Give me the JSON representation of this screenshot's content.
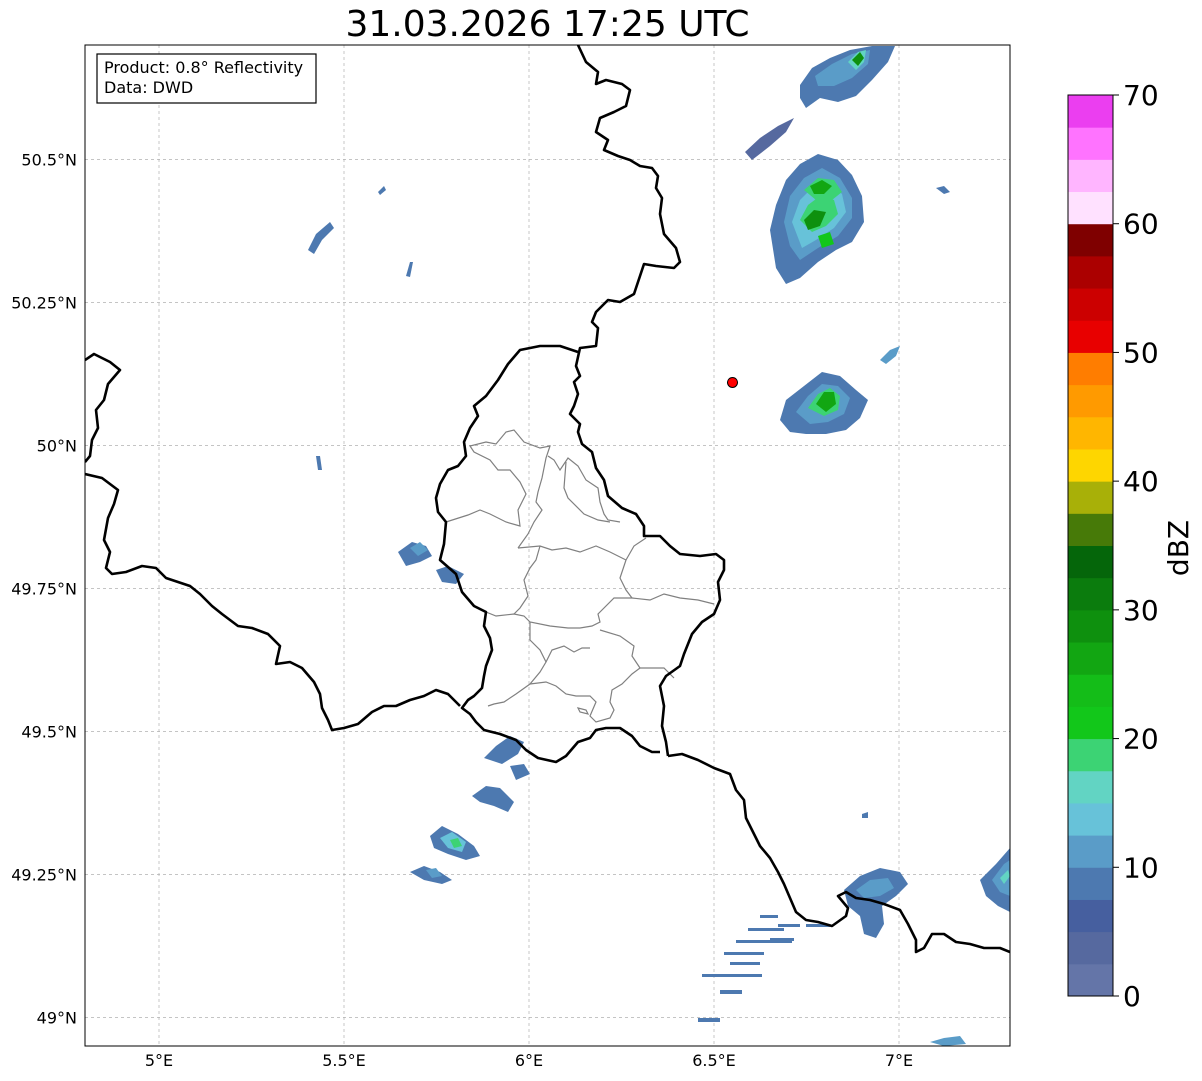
{
  "title": "31.03.2026 17:25 UTC",
  "info_box": {
    "product_line": "Product: 0.8° Reflectivity",
    "data_line": "Data: DWD"
  },
  "map": {
    "type": "radar-reflectivity-map",
    "extent": {
      "lon_min": 4.8,
      "lon_max": 7.3,
      "lat_min": 48.95,
      "lat_max": 50.7
    },
    "grid": true,
    "lon_ticks": [
      {
        "value": 5.0,
        "label": "5°E"
      },
      {
        "value": 5.5,
        "label": "5.5°E"
      },
      {
        "value": 6.0,
        "label": "6°E"
      },
      {
        "value": 6.5,
        "label": "6.5°E"
      },
      {
        "value": 7.0,
        "label": "7°E"
      }
    ],
    "lat_ticks": [
      {
        "value": 50.5,
        "label": "50.5°N"
      },
      {
        "value": 50.25,
        "label": "50.25°N"
      },
      {
        "value": 50.0,
        "label": "50°N"
      },
      {
        "value": 49.75,
        "label": "49.75°N"
      },
      {
        "value": 49.5,
        "label": "49.5°N"
      },
      {
        "value": 49.25,
        "label": "49.25°N"
      },
      {
        "value": 49.0,
        "label": "49°N"
      }
    ],
    "radar_site": {
      "lon": 6.55,
      "lat": 50.11,
      "color": "#ff0000"
    },
    "echoes": [
      {
        "lon": 6.87,
        "lat": 50.63,
        "dbz": 15
      },
      {
        "lon": 6.8,
        "lat": 50.42,
        "dbz": 22
      },
      {
        "lon": 6.78,
        "lat": 50.36,
        "dbz": 18
      },
      {
        "lon": 6.81,
        "lat": 50.09,
        "dbz": 20
      },
      {
        "lon": 6.67,
        "lat": 50.54,
        "dbz": 8
      },
      {
        "lon": 5.43,
        "lat": 50.37,
        "dbz": 5
      },
      {
        "lon": 5.6,
        "lat": 50.45,
        "dbz": 3
      },
      {
        "lon": 5.7,
        "lat": 49.81,
        "dbz": 7
      },
      {
        "lon": 5.93,
        "lat": 49.47,
        "dbz": 6
      },
      {
        "lon": 5.88,
        "lat": 49.37,
        "dbz": 6
      },
      {
        "lon": 5.78,
        "lat": 49.3,
        "dbz": 12
      },
      {
        "lon": 5.74,
        "lat": 49.24,
        "dbz": 9
      },
      {
        "lon": 6.95,
        "lat": 49.23,
        "dbz": 8
      },
      {
        "lon": 7.27,
        "lat": 49.25,
        "dbz": 14
      },
      {
        "lon": 6.6,
        "lat": 49.1,
        "dbz": 4
      },
      {
        "lon": 7.15,
        "lat": 48.96,
        "dbz": 10
      }
    ]
  },
  "colorbar": {
    "label": "dBZ",
    "min": 0,
    "max": 70,
    "tick_labels": [
      "0",
      "10",
      "20",
      "30",
      "40",
      "50",
      "60",
      "70"
    ],
    "colors": [
      "#6475a8",
      "#56699f",
      "#465f9f",
      "#4d79b0",
      "#5a9cc8",
      "#67c2d9",
      "#62d4c3",
      "#3cd374",
      "#12c71a",
      "#14bd18",
      "#12a612",
      "#0e900e",
      "#0b7c0d",
      "#05660a",
      "#477a08",
      "#a8b008",
      "#fed600",
      "#ffb600",
      "#ff9a00",
      "#ff7d00",
      "#e80000",
      "#cc0000",
      "#ab0000",
      "#7f0000",
      "#ffe1ff",
      "#ffb5ff",
      "#ff73ff",
      "#eb3ef0"
    ]
  }
}
